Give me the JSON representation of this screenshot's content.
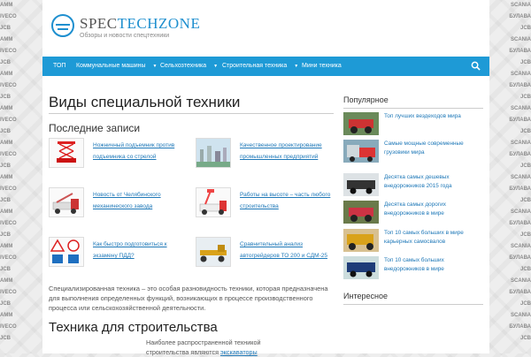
{
  "site": {
    "name_part1": "SPEC",
    "name_part2": "TECHZONE",
    "tagline": "Обзоры и новости спецтехники"
  },
  "background_brands": {
    "left": [
      "AMM",
      "IVECO",
      "JCB",
      "AMM",
      "IVECO",
      "JCB",
      "AMM",
      "IVECO",
      "JCB",
      "AMM",
      "IVECO",
      "JCB",
      "AMM",
      "IVECO",
      "JCB",
      "AMM",
      "IVECO",
      "JCB",
      "AMM",
      "IVECO",
      "JCB",
      "AMM",
      "IVECO",
      "JCB",
      "AMM",
      "IVECO",
      "JCB",
      "AMM",
      "IVECO",
      "JCB"
    ],
    "right": [
      "SCANIA",
      "БУЛАВА",
      "JCB",
      "SCANIA",
      "БУЛАВА",
      "JCB",
      "SCANIA",
      "БУЛАВА",
      "JCB",
      "SCANIA",
      "БУЛАВА",
      "JCB",
      "SCANIA",
      "БУЛАВА",
      "JCB",
      "SCANIA",
      "БУЛАВА",
      "JCB",
      "SCANIA",
      "БУЛАВА",
      "JCB",
      "SCANIA",
      "БУЛАВА",
      "JCB",
      "SCANIA",
      "БУЛАВА",
      "JCB",
      "SCANIA",
      "БУЛАВА",
      "JCB"
    ]
  },
  "nav": {
    "items": [
      {
        "label": "ТОП",
        "caret": ""
      },
      {
        "label": "Коммунальные машины",
        "caret": "▼"
      },
      {
        "label": "Сельхозтехника",
        "caret": "▼"
      },
      {
        "label": "Строительная техника",
        "caret": "▼"
      },
      {
        "label": "Мини техника",
        "caret": ""
      }
    ],
    "search_icon": "search-icon"
  },
  "main": {
    "page_title": "Виды специальной техники",
    "recent_title": "Последние записи",
    "posts": [
      {
        "title": "Ножничный подъемник против подъемника со стрелой",
        "icon": "scissor-lift"
      },
      {
        "title": "Качественное проектирование промышленных предприятий",
        "icon": "factory"
      },
      {
        "title": "Новость от Челябинского механического завода",
        "icon": "truck-crane"
      },
      {
        "title": "Работы на высоте – часть любого строительства",
        "icon": "aerial-platform"
      },
      {
        "title": "Как быстро подготовиться к экзамену ПДД?",
        "icon": "road-signs"
      },
      {
        "title": "Сравнительный анализ автогрейдеров ТО 200 и СДМ-25",
        "icon": "grader"
      }
    ],
    "body_text": "Специализированная техника – это особая разновидность техники, которая предназначена для выполнения определенных функций, возникающих в процессе производственного процесса или сельскохозяйственной деятельности.",
    "section2_title": "Техника для строительства",
    "intro_text": "Наиболее распространенной техникой",
    "intro_text_2": "строительства являются ",
    "intro_link": "экскаваторы"
  },
  "sidebar": {
    "popular_title": "Популярное",
    "popular": [
      {
        "title": "Топ лучших вездеходов мира"
      },
      {
        "title": "Самые мощные современные грузовики мира"
      },
      {
        "title": "Десятка самых дешевых внедорожников 2015 года"
      },
      {
        "title": "Десятка самых дорогих внедорожников в мире"
      },
      {
        "title": "Топ 10 самых больших в мире карьерных самосвалов"
      },
      {
        "title": "Топ 10 самых больших внедорожников в мире"
      }
    ],
    "interesting_title": "Интересное"
  },
  "colors": {
    "accent": "#1e9ad6",
    "link": "#1e78b8"
  }
}
